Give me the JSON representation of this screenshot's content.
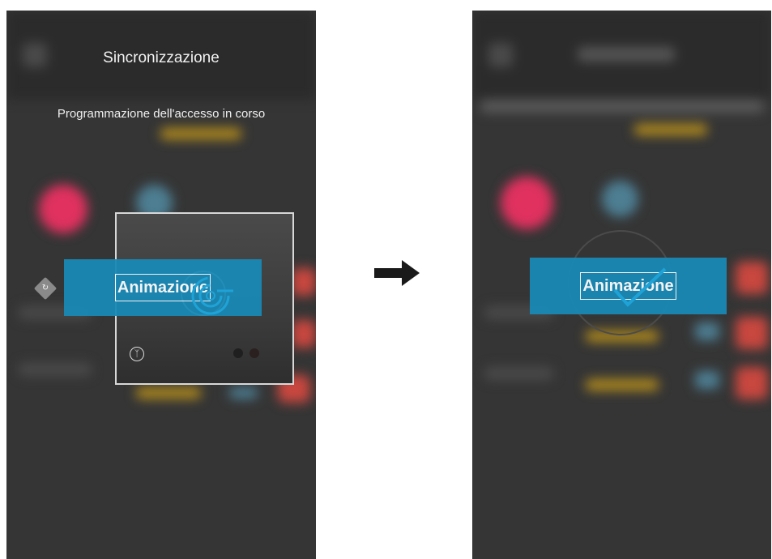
{
  "left_screen": {
    "title": "Sincronizzazione",
    "subtitle": "Programmazione dell'accesso in corso",
    "overlay_label": "Animazione"
  },
  "right_screen": {
    "overlay_label": "Animazione"
  },
  "icons": {
    "arrow": "arrow-right-icon",
    "bluetooth": "bluetooth-icon",
    "sync": "sync-icon",
    "check": "checkmark-icon",
    "refresh": "refresh-icon"
  },
  "colors": {
    "background": "#353535",
    "banner": "#1989b6",
    "pink": "#e0315f",
    "blue": "#4d7e92",
    "red": "#c8473f",
    "yellow": "#b08a1e"
  }
}
